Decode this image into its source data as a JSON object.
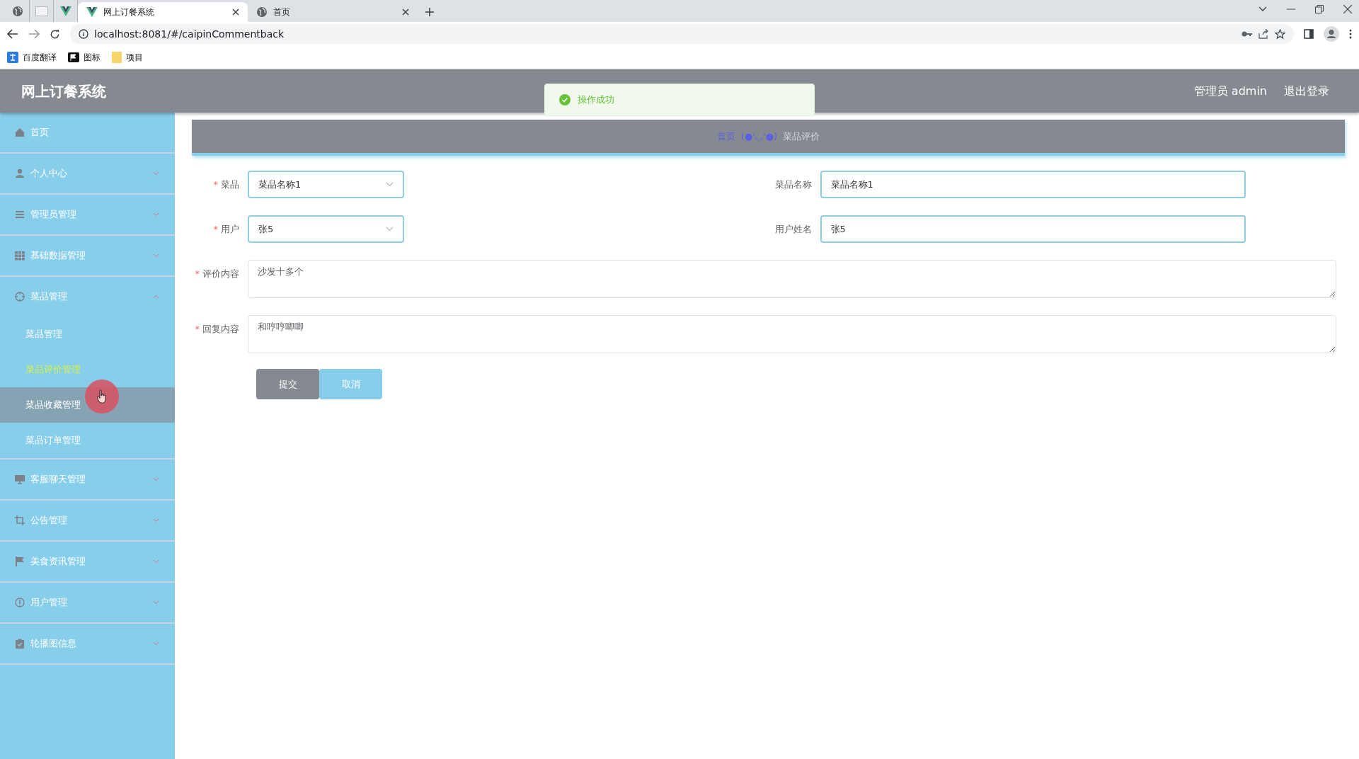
{
  "browser": {
    "tabs": [
      {
        "kind": "pinned",
        "selected": false
      },
      {
        "kind": "pinned",
        "selected": false
      },
      {
        "kind": "pinned",
        "selected": false
      },
      {
        "kind": "page",
        "label": "网上订餐系统",
        "selected": true
      },
      {
        "kind": "page",
        "label": "首页",
        "selected": false
      }
    ],
    "url": "localhost:8081/#/caipinCommentback",
    "bookmarks": [
      "百度翻译",
      "图标",
      "项目"
    ]
  },
  "header": {
    "title": "网上订餐系统",
    "user": "管理员 admin",
    "logout": "退出登录"
  },
  "toast": {
    "text": "操作成功"
  },
  "sidebar": {
    "items": [
      {
        "label": "首页",
        "kind": "link"
      },
      {
        "label": "个人中心",
        "kind": "menu",
        "expanded": false
      },
      {
        "label": "管理员管理",
        "kind": "menu",
        "expanded": false
      },
      {
        "label": "基础数据管理",
        "kind": "menu",
        "expanded": false
      },
      {
        "label": "菜品管理",
        "kind": "menu",
        "expanded": true,
        "children": [
          {
            "label": "菜品管理",
            "selected": false,
            "hovered": false
          },
          {
            "label": "菜品评价管理",
            "selected": true,
            "hovered": false
          },
          {
            "label": "菜品收藏管理",
            "selected": false,
            "hovered": true
          },
          {
            "label": "菜品订单管理",
            "selected": false,
            "hovered": false
          }
        ]
      },
      {
        "label": "客服聊天管理",
        "kind": "menu",
        "expanded": false
      },
      {
        "label": "公告管理",
        "kind": "menu",
        "expanded": false
      },
      {
        "label": "美食资讯管理",
        "kind": "menu",
        "expanded": false
      },
      {
        "label": "用户管理",
        "kind": "menu",
        "expanded": false
      },
      {
        "label": "轮播图信息",
        "kind": "menu",
        "expanded": false
      }
    ]
  },
  "breadcrumb": [
    "首页",
    "(●'◡'●)",
    "菜品评价"
  ],
  "form": {
    "fields": [
      {
        "kind": "select",
        "required_mark": "*",
        "label": "菜品",
        "value": "菜品名称1"
      },
      {
        "kind": "input",
        "label": "菜品名称",
        "value": "菜品名称1"
      },
      {
        "kind": "select",
        "required_mark": "*",
        "label": "用户",
        "value": "张5"
      },
      {
        "kind": "input",
        "label": "用户姓名",
        "value": "张5"
      },
      {
        "kind": "textarea",
        "required_mark": "*",
        "label": "评价内容",
        "value": "沙发十多个"
      },
      {
        "kind": "textarea",
        "required_mark": "*",
        "label": "回复内容",
        "value": "和哼哼唧唧"
      }
    ],
    "buttons": [
      {
        "kind": "submit",
        "label": "提交"
      },
      {
        "kind": "cancel",
        "label": "取消"
      }
    ]
  }
}
